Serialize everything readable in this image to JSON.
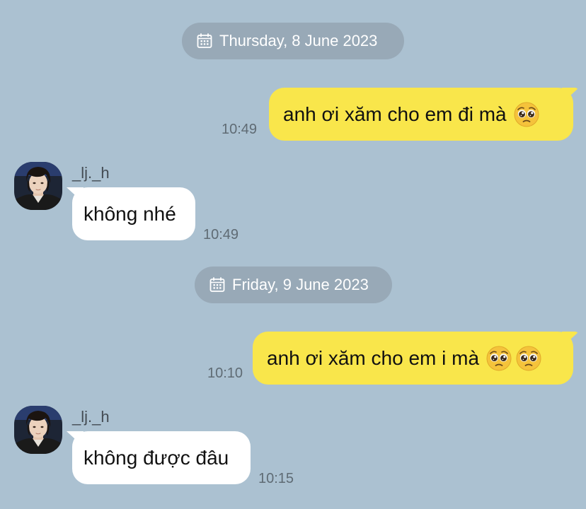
{
  "chat": {
    "date1": "Thursday, 8 June 2023",
    "date2": "Friday, 9 June 2023",
    "messages": [
      {
        "text": "anh ơi xăm cho em đi mà",
        "time": "10:49",
        "emoji": [
          "pleading-face"
        ]
      },
      {
        "sender": "_lj._h",
        "text": "không nhé",
        "time": "10:49"
      },
      {
        "text": "anh ơi xăm cho em i mà",
        "time": "10:10",
        "emoji": [
          "pleading-face",
          "pleading-face"
        ]
      },
      {
        "sender": "_lj._h",
        "text": "không được đâu",
        "time": "10:15"
      }
    ]
  },
  "colors": {
    "background": "#abc1d1",
    "my_bubble": "#f9e64b",
    "their_bubble": "#ffffff",
    "date_pill": "#98a9b7"
  }
}
